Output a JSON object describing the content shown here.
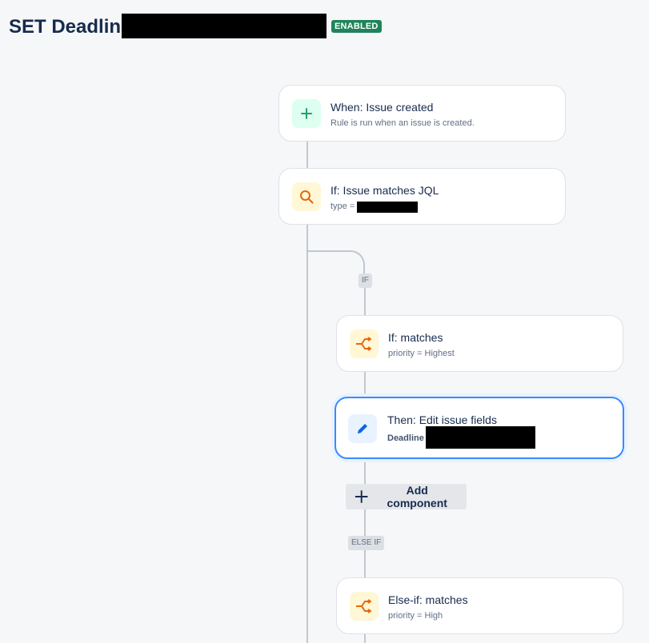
{
  "header": {
    "title": "SET Deadline",
    "status_badge": "ENABLED",
    "status_color": "#1f845a"
  },
  "trigger": {
    "title": "When: Issue created",
    "subtitle": "Rule is run when an issue is created.",
    "icon": "plus-icon"
  },
  "condition": {
    "title": "If: Issue matches JQL",
    "subtitle": "type =",
    "icon": "search-icon"
  },
  "branches": {
    "if_label": "IF",
    "else_if_label": "ELSE IF"
  },
  "if_branch": {
    "title": "If: matches",
    "subtitle": "priority = Highest",
    "icon": "branch-icon"
  },
  "action": {
    "title": "Then: Edit issue fields",
    "subtitle": "Deadline",
    "icon": "pencil-icon"
  },
  "add_component_label": "Add component",
  "else_if_branch": {
    "title": "Else-if: matches",
    "subtitle": "priority = High",
    "icon": "branch-icon"
  },
  "colors": {
    "accent": "#388bff",
    "icon_green": "#22a06b",
    "icon_orange": "#e56910",
    "icon_blue": "#0c66e4"
  }
}
